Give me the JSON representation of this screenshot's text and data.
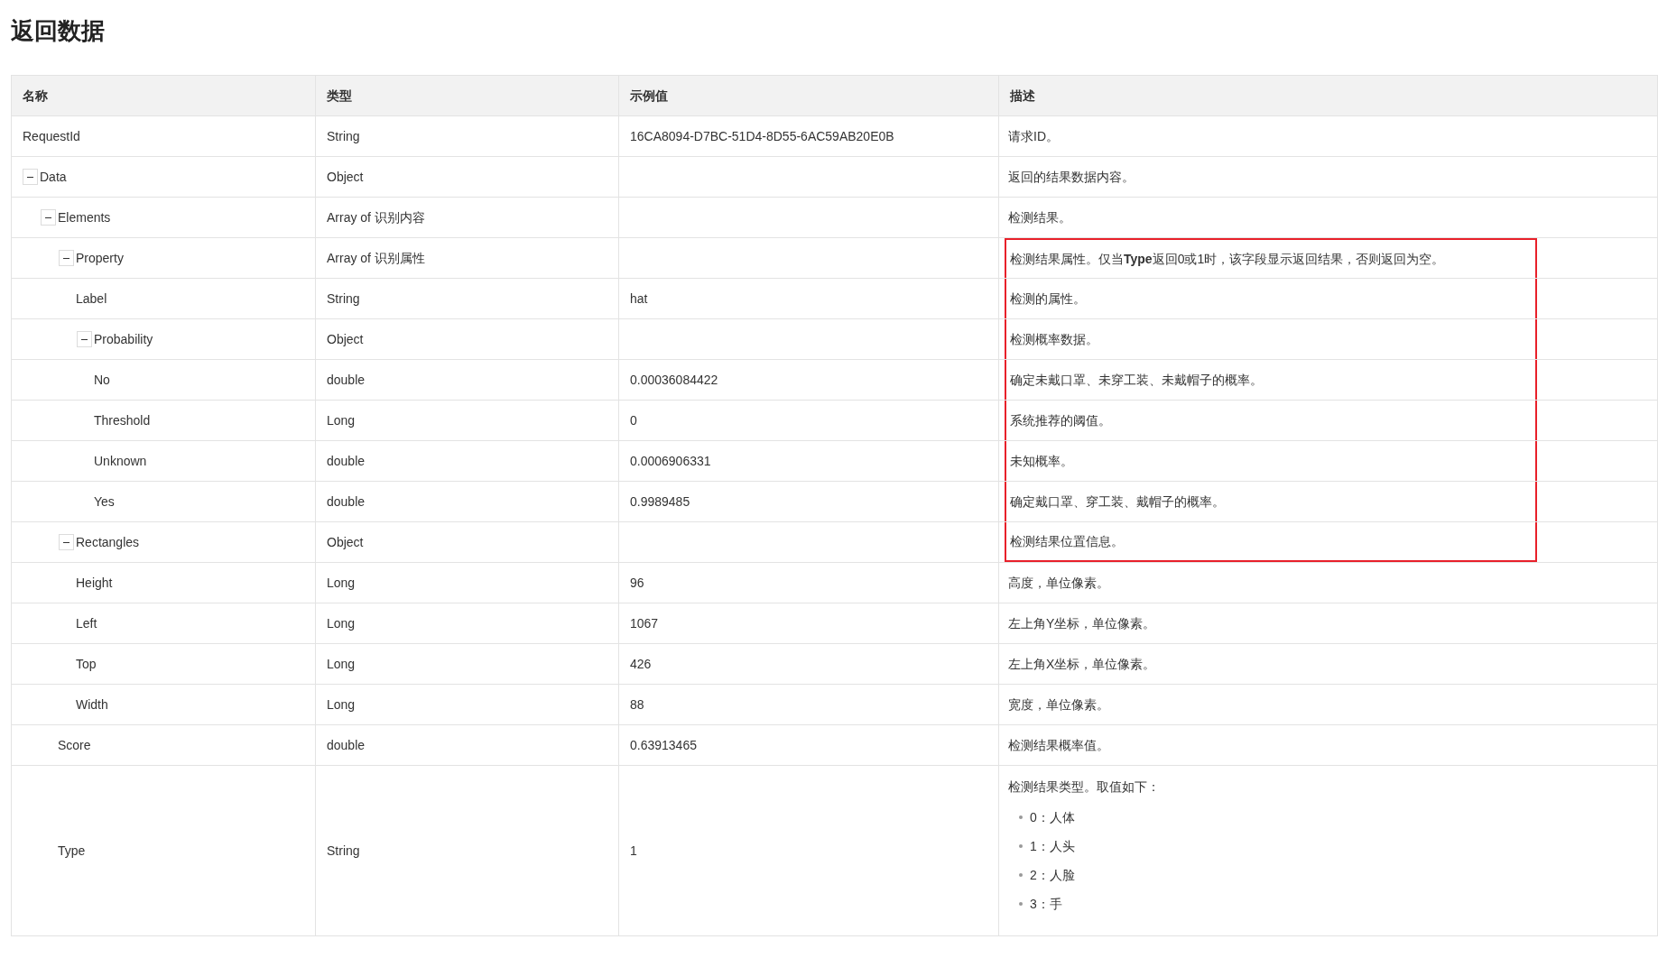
{
  "title": "返回数据",
  "table": {
    "columns": [
      "名称",
      "类型",
      "示例值",
      "描述"
    ],
    "rows": [
      {
        "name": "RequestId",
        "type": "String",
        "example": "16CA8094-D7BC-51D4-8D55-6AC59AB20E0B",
        "description": "请求ID。",
        "highlighted": false
      },
      {
        "name": "Data",
        "type": "Object",
        "description": "返回的结果数据内容。",
        "highlighted": false,
        "expanded": true,
        "children": [
          {
            "name": "Elements",
            "type": "Array of 识别内容",
            "description": "检测结果。",
            "highlighted": false,
            "expanded": true,
            "children": [
              {
                "name": "Property",
                "type": "Array of 识别属性",
                "description": "检测结果属性。仅当**Type**返回0或1时，该字段显示返回结果，否则返回为空。",
                "highlighted": true,
                "expanded": true,
                "children": [
                  {
                    "name": "Label",
                    "type": "String",
                    "example": "hat",
                    "description": "检测的属性。",
                    "highlighted": true
                  },
                  {
                    "name": "Probability",
                    "type": "Object",
                    "description": "检测概率数据。",
                    "highlighted": true,
                    "expanded": true,
                    "children": [
                      {
                        "name": "No",
                        "type": "double",
                        "example": "0.00036084422",
                        "description": "确定未戴口罩、未穿工装、未戴帽子的概率。",
                        "highlighted": true
                      },
                      {
                        "name": "Threshold",
                        "type": "Long",
                        "example": "0",
                        "description": "系统推荐的阈值。",
                        "highlighted": true
                      },
                      {
                        "name": "Unknown",
                        "type": "double",
                        "example": "0.0006906331",
                        "description": "未知概率。",
                        "highlighted": true
                      },
                      {
                        "name": "Yes",
                        "type": "double",
                        "example": "0.9989485",
                        "description": "确定戴口罩、穿工装、戴帽子的概率。",
                        "highlighted": true
                      }
                    ]
                  }
                ]
              },
              {
                "name": "Rectangles",
                "type": "Object",
                "description": "检测结果位置信息。",
                "highlighted": true,
                "expanded": true,
                "children": [
                  {
                    "name": "Height",
                    "type": "Long",
                    "example": "96",
                    "description": "高度，单位像素。",
                    "highlighted": false
                  },
                  {
                    "name": "Left",
                    "type": "Long",
                    "example": "1067",
                    "description": "左上角Y坐标，单位像素。",
                    "highlighted": false
                  },
                  {
                    "name": "Top",
                    "type": "Long",
                    "example": "426",
                    "description": "左上角X坐标，单位像素。",
                    "highlighted": false
                  },
                  {
                    "name": "Width",
                    "type": "Long",
                    "example": "88",
                    "description": "宽度，单位像素。",
                    "highlighted": false
                  }
                ]
              },
              {
                "name": "Score",
                "type": "double",
                "example": "0.63913465",
                "description": "检测结果概率值。",
                "highlighted": false
              },
              {
                "name": "Type",
                "type": "String",
                "example": "1",
                "description": "检测结果类型。取值如下：",
                "highlighted": false,
                "description_items": [
                  "0：人体",
                  "1：人头",
                  "2：人脸",
                  "3：手"
                ]
              }
            ]
          }
        ]
      }
    ]
  }
}
